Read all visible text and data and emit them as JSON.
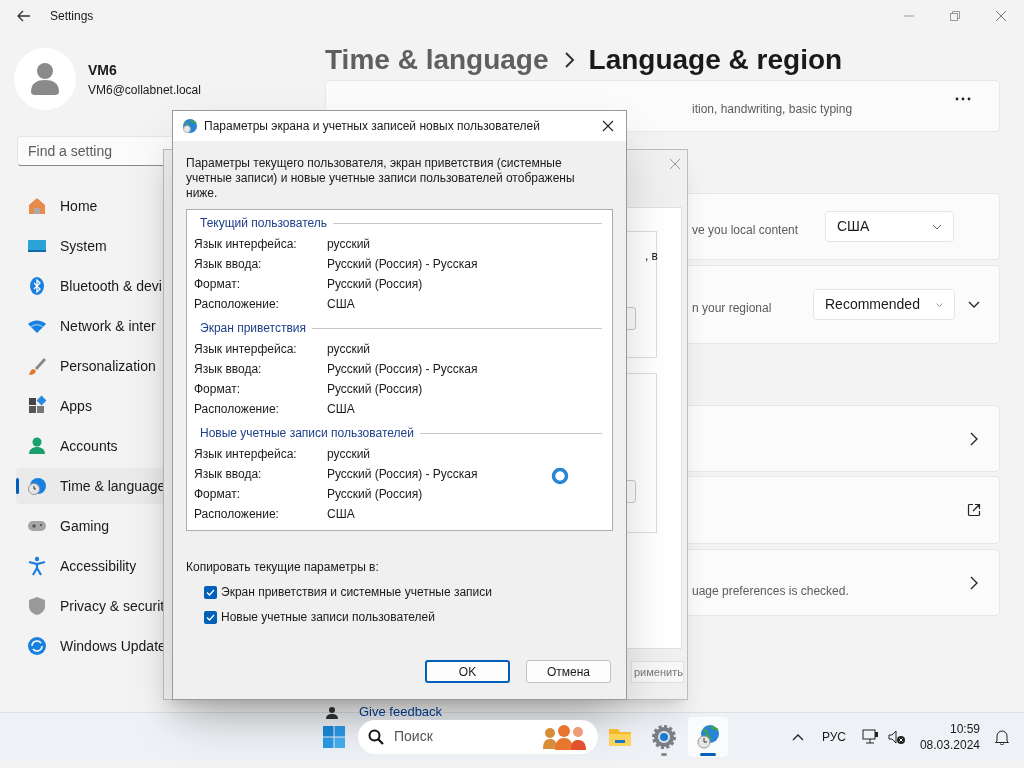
{
  "window": {
    "title": "Settings"
  },
  "account": {
    "name": "VM6",
    "email": "VM6@collabnet.local"
  },
  "search": {
    "placeholder": "Find a setting"
  },
  "nav": [
    {
      "label": "Home",
      "selected": false
    },
    {
      "label": "System",
      "selected": false
    },
    {
      "label": "Bluetooth & devi",
      "selected": false
    },
    {
      "label": "Network & inter",
      "selected": false
    },
    {
      "label": "Personalization",
      "selected": false
    },
    {
      "label": "Apps",
      "selected": false
    },
    {
      "label": "Accounts",
      "selected": false
    },
    {
      "label": "Time & language",
      "selected": true
    },
    {
      "label": "Gaming",
      "selected": false
    },
    {
      "label": "Accessibility",
      "selected": false
    },
    {
      "label": "Privacy & securit",
      "selected": false
    },
    {
      "label": "Windows Update",
      "selected": false
    }
  ],
  "breadcrumb": {
    "parent": "Time & language",
    "current": "Language & region"
  },
  "cards": [
    {
      "kind": "more",
      "text": "ition, handwriting, basic typing"
    },
    {
      "kind": "dropdown",
      "text": "ve you local content",
      "value": "США"
    },
    {
      "kind": "dropdown-expand",
      "text": "n your regional",
      "value": "Recommended"
    },
    {
      "kind": "link"
    },
    {
      "kind": "external"
    },
    {
      "kind": "link",
      "text": "uage preferences is checked."
    }
  ],
  "feedback": "Give feedback",
  "back_dialog": {
    "fragment": ", в",
    "button": "рименить"
  },
  "dialog": {
    "title": "Параметры экрана и учетных записей новых пользователей",
    "description": "Параметры текущего пользователя, экран приветствия (системные учетные записи) и новые учетные записи пользователей отображены ниже.",
    "sections": [
      {
        "title": "Текущий пользователь",
        "rows": [
          {
            "label": "Язык интерфейса:",
            "value": "русский"
          },
          {
            "label": "Язык ввода:",
            "value": "Русский (Россия) - Русская"
          },
          {
            "label": "Формат:",
            "value": "Русский (Россия)"
          },
          {
            "label": "Расположение:",
            "value": "США"
          }
        ]
      },
      {
        "title": "Экран приветствия",
        "rows": [
          {
            "label": "Язык интерфейса:",
            "value": "русский"
          },
          {
            "label": "Язык ввода:",
            "value": "Русский (Россия) - Русская"
          },
          {
            "label": "Формат:",
            "value": "Русский (Россия)"
          },
          {
            "label": "Расположение:",
            "value": "США"
          }
        ]
      },
      {
        "title": "Новые учетные записи пользователей",
        "rows": [
          {
            "label": "Язык интерфейса:",
            "value": "русский"
          },
          {
            "label": "Язык ввода:",
            "value": "Русский (Россия) - Русская"
          },
          {
            "label": "Формат:",
            "value": "Русский (Россия)"
          },
          {
            "label": "Расположение:",
            "value": "США"
          }
        ]
      }
    ],
    "busy": true,
    "copy_label": "Копировать текущие параметры в:",
    "checkboxes": [
      {
        "label": "Экран приветствия и системные учетные записи",
        "checked": true
      },
      {
        "label": "Новые учетные записи пользователей",
        "checked": true
      }
    ],
    "buttons": [
      {
        "label": "OK",
        "default": true
      },
      {
        "label": "Отмена",
        "default": false
      }
    ]
  },
  "taskbar": {
    "placeholder": "Поиск",
    "apps": [
      {
        "kind": "explorer",
        "active": false,
        "running": false
      },
      {
        "kind": "settings",
        "active": false,
        "running": true
      },
      {
        "kind": "globe",
        "active": true,
        "running": true
      }
    ],
    "language": "РУС",
    "time": "10:59",
    "date": "08.03.2024"
  }
}
